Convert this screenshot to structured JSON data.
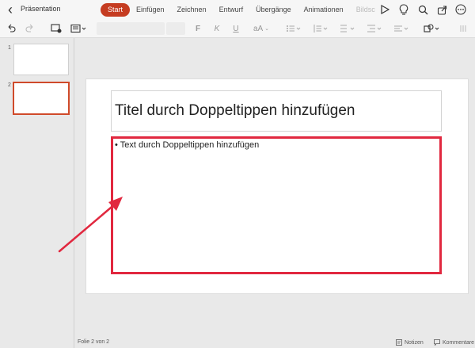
{
  "app": {
    "document_title": "Präsentation"
  },
  "tabs": [
    {
      "label": "Start",
      "active": true
    },
    {
      "label": "Einfügen"
    },
    {
      "label": "Zeichnen"
    },
    {
      "label": "Entwurf"
    },
    {
      "label": "Übergänge"
    },
    {
      "label": "Animationen"
    },
    {
      "label": "Bildsc"
    }
  ],
  "top_icons": [
    "play-icon",
    "lightbulb-icon",
    "search-icon",
    "share-icon",
    "more-icon"
  ],
  "ribbon": {
    "bold": "F",
    "italic": "K",
    "underline": "U",
    "font_size_label": "aA"
  },
  "thumbnails": [
    {
      "number": "1",
      "selected": false
    },
    {
      "number": "2",
      "selected": true
    }
  ],
  "slide": {
    "title_placeholder": "Titel durch Doppeltippen hinzufügen",
    "body_placeholder": "Text durch Doppeltippen hinzufügen",
    "bullet": "•"
  },
  "status": {
    "slide_counter": "Folie 2 von 2",
    "notes": "Notizen",
    "comments": "Kommentare"
  },
  "colors": {
    "accent": "#c53c21",
    "highlight": "#e1283f"
  }
}
